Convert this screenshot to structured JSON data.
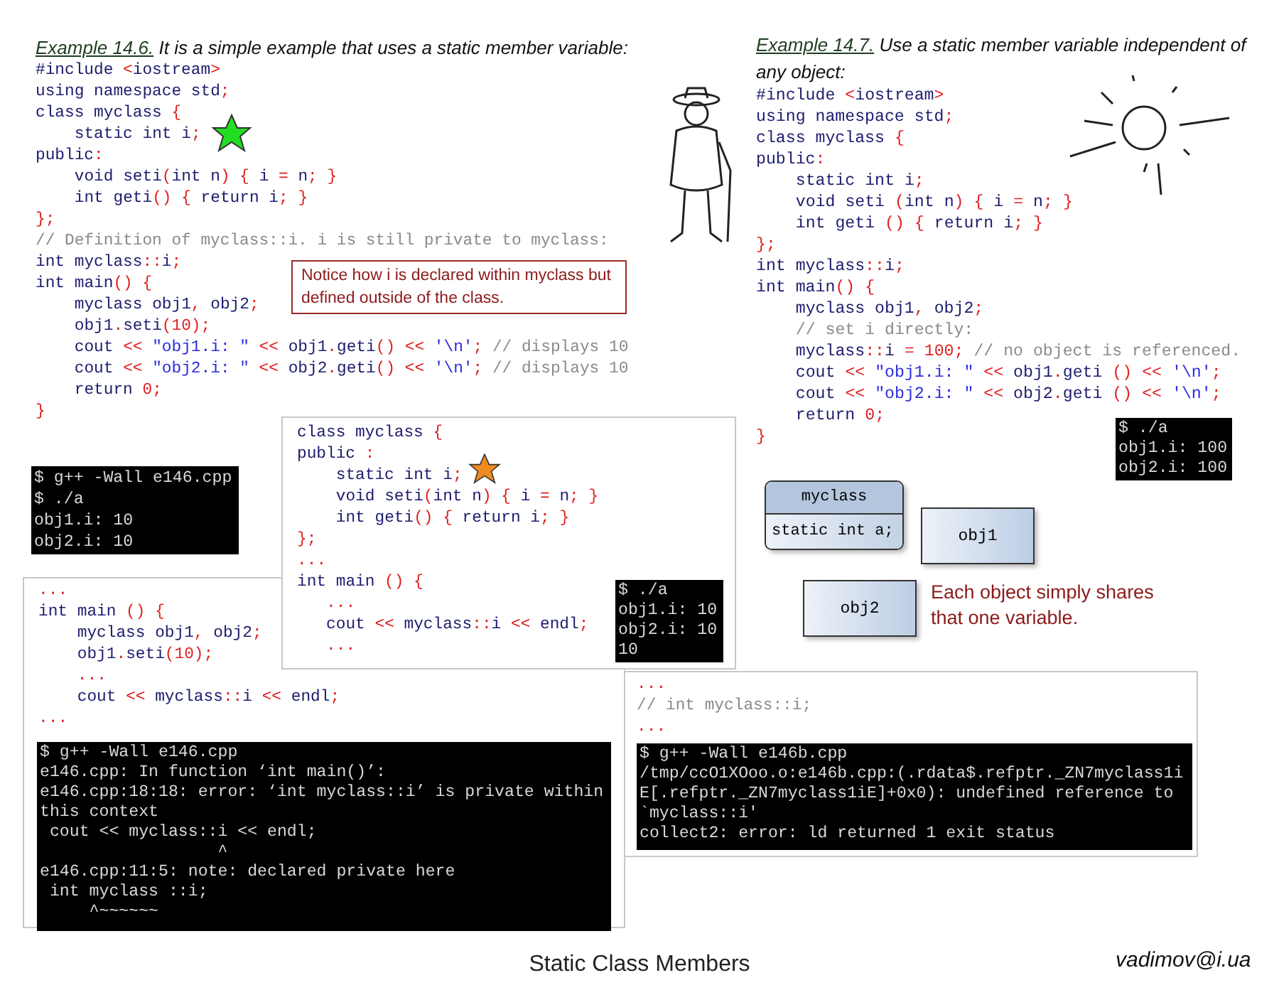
{
  "examples": [
    {
      "label": "Example 14.6.",
      "text": "It is a simple example that uses a static member variable:",
      "code": [
        "#include <iostream>",
        "using namespace std;",
        "class myclass {",
        "    static int i;",
        "public:",
        "    void seti(int n) { i = n; }",
        "    int geti() { return i; }",
        "};",
        "// Definition of myclass::i. i is still private to myclass:",
        "int myclass::i;",
        "int main() {",
        "    myclass obj1, obj2;",
        "    obj1.seti(10);",
        "    cout << \"obj1.i: \" << obj1.geti() << '\\n'; // displays 10",
        "    cout << \"obj2.i: \" << obj2.geti() << '\\n'; // displays 10",
        "    return 0;",
        "}"
      ]
    },
    {
      "label": "Example 14.7.",
      "text": "Use a static member variable independent of any object:",
      "code": [
        "#include <iostream>",
        "using namespace std;",
        "class myclass {",
        "public:",
        "    static int i;",
        "    void seti (int n) { i = n; }",
        "    int geti () { return i; }",
        "};",
        "int myclass::i;",
        "int main() {",
        "    myclass obj1, obj2;",
        "    // set i directly:",
        "    myclass::i = 100; // no object is referenced.",
        "    cout << \"obj1.i: \" << obj1.geti () << '\\n';",
        "    cout << \"obj2.i: \" << obj2.geti () << '\\n';",
        "    return 0;",
        "}"
      ]
    }
  ],
  "note": "Notice how i is declared within myclass but defined outside of the class.",
  "output_left": [
    "$ g++ -Wall e146.cpp",
    "$ ./a",
    "obj1.i: 10",
    "obj2.i: 10"
  ],
  "output_right": [
    "$ ./a",
    "obj1.i: 100",
    "obj2.i: 100"
  ],
  "snippet_bottom_left": {
    "code": [
      "...",
      "int main () {",
      "    myclass obj1, obj2;",
      "    obj1.seti(10);",
      "    ...",
      "    cout << myclass::i << endl;",
      "..."
    ],
    "output": [
      "$ g++ -Wall e146.cpp",
      "e146.cpp: In function ‘int main()’:",
      "e146.cpp:18:18: error: ‘int myclass::i’ is private within",
      "this context",
      " cout << myclass::i << endl;",
      "                  ^",
      "e146.cpp:11:5: note: declared private here",
      " int myclass ::i;",
      "     ^~~~~~~"
    ]
  },
  "snippet_middle": {
    "code": [
      "class myclass {",
      "public :",
      "    static int i;",
      "    void seti(int n) { i = n; }",
      "    int geti() { return i; }",
      "};",
      "...",
      "int main () {",
      "   ...",
      "   cout << myclass::i << endl;",
      "   ..."
    ],
    "output": [
      "$ ./a",
      "obj1.i: 10",
      "obj2.i: 10",
      "10"
    ]
  },
  "snippet_bottom_right": {
    "code": [
      "...",
      "// int myclass::i;",
      "..."
    ],
    "output": [
      "$ g++ -Wall e146b.cpp",
      "/tmp/ccO1XOoo.o:e146b.cpp:(.rdata$.refptr._ZN7myclass1i",
      "E[.refptr._ZN7myclass1iE]+0x0): undefined reference to",
      "`myclass::i'",
      "collect2: error: ld returned 1 exit status"
    ]
  },
  "diagram": {
    "class_name": "myclass",
    "member": "static int a;",
    "objects": [
      "obj1",
      "obj2"
    ],
    "caption": "Each object simply shares that one variable."
  },
  "footer": {
    "title": "Static Class Members",
    "author": "vadimov@i.ua"
  }
}
